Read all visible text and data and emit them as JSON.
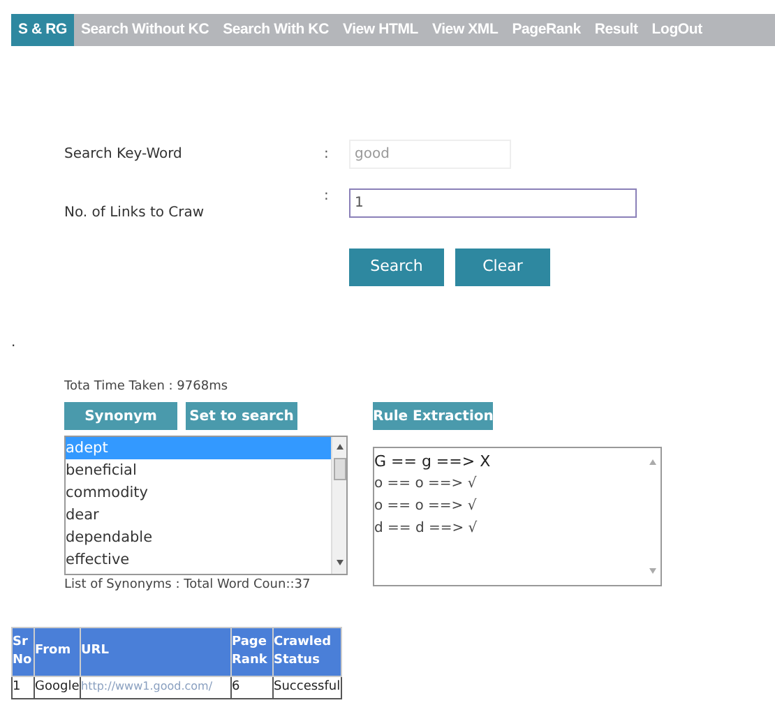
{
  "nav": [
    {
      "label": "S & RG",
      "selected": true
    },
    {
      "label": "Search Without KC",
      "selected": false
    },
    {
      "label": "Search With KC",
      "selected": false
    },
    {
      "label": "View HTML",
      "selected": false
    },
    {
      "label": "View XML",
      "selected": false
    },
    {
      "label": "PageRank",
      "selected": false
    },
    {
      "label": "Result",
      "selected": false
    },
    {
      "label": "LogOut",
      "selected": false
    }
  ],
  "form": {
    "fields": [
      {
        "label": "Search Key-Word",
        "separator": ":",
        "value": "good",
        "disabled": true
      },
      {
        "label": "No. of Links to Craw",
        "separator": ":",
        "value": "1",
        "disabled": false
      }
    ],
    "buttons": [
      "Search",
      "Clear"
    ]
  },
  "marker": ".",
  "time_taken": "Tota Time Taken : 9768ms",
  "synonym_buttons": [
    "Synonym",
    "Set to search"
  ],
  "rule_button": "Rule Extraction",
  "synonyms": [
    {
      "label": "adept",
      "selected": true
    },
    {
      "label": "beneficial",
      "selected": false
    },
    {
      "label": "commodity",
      "selected": false
    },
    {
      "label": "dear",
      "selected": false
    },
    {
      "label": "dependable",
      "selected": false
    },
    {
      "label": "effective",
      "selected": false
    }
  ],
  "rules": [
    "G == g ==> X",
    "o == o ==> √",
    "o == o ==> √",
    "d == d ==> √"
  ],
  "synonym_count": "List of Synonyms : Total Word Coun::37",
  "table": {
    "columns": [
      "Sr No",
      "From",
      "URL",
      "Page Rank",
      "Crawled Status"
    ],
    "rows": [
      [
        "1",
        "Google",
        "http://www1.good.com/",
        "6",
        "Successful"
      ]
    ]
  }
}
